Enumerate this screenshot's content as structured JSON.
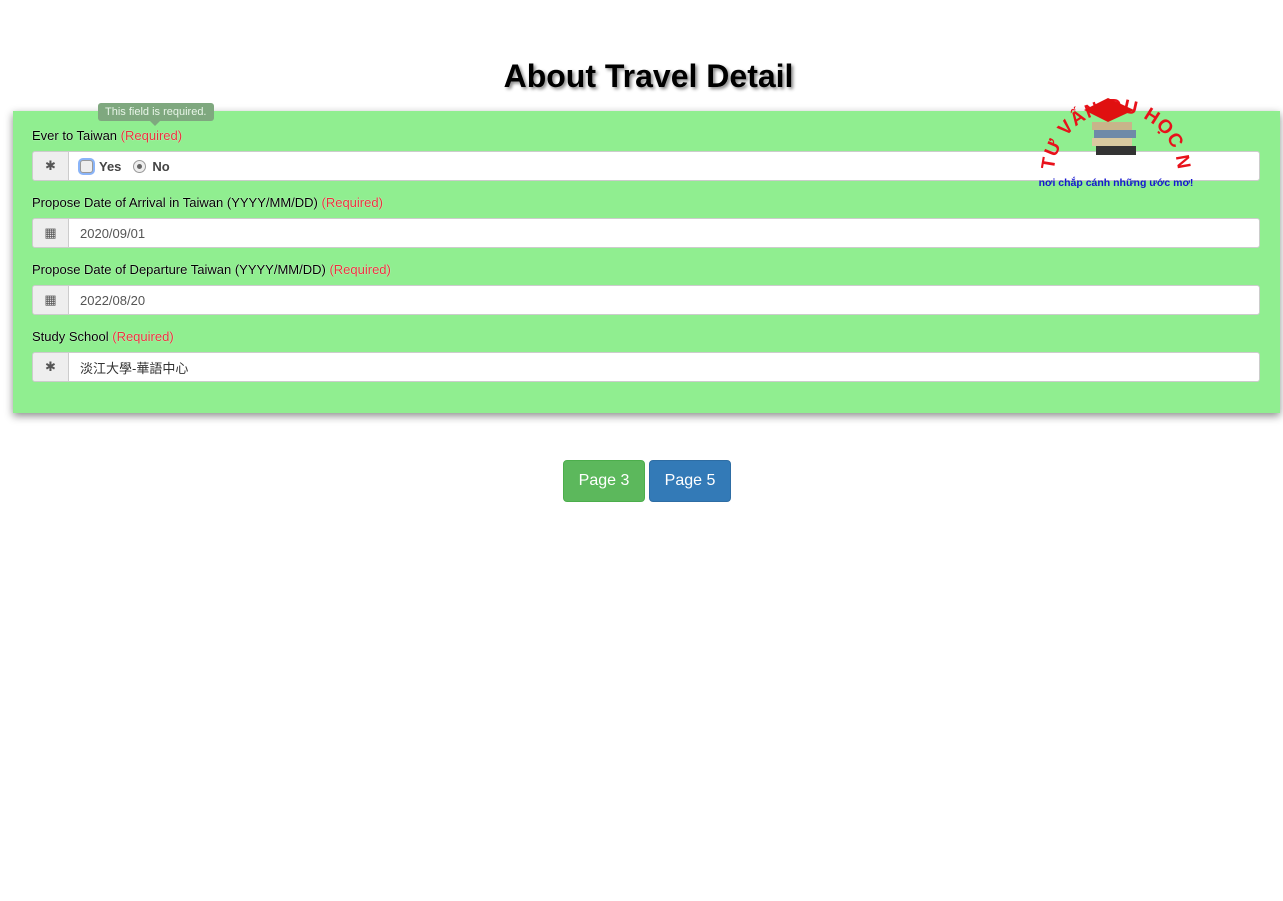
{
  "title": "About Travel Detail",
  "tooltip": "This field is required.",
  "required_mark": "(Required)",
  "fields": [
    {
      "label": "Ever to Taiwan",
      "icon": "asterisk-icon",
      "options": [
        "Yes",
        "No"
      ],
      "selected": "No"
    },
    {
      "label": "Propose Date of Arrival in Taiwan (YYYY/MM/DD)",
      "icon": "calendar-icon",
      "value": "2020/09/01"
    },
    {
      "label": "Propose Date of Departure Taiwan (YYYY/MM/DD)",
      "icon": "calendar-icon",
      "value": "2022/08/20"
    },
    {
      "label": "Study School",
      "icon": "asterisk-icon",
      "value": "淡江大學-華語中心"
    }
  ],
  "buttons": {
    "prev": "Page 3",
    "next": "Page 5"
  },
  "colors": {
    "panel": "#90ee90",
    "required": "#e8333a",
    "prev_button": "#5cb85c",
    "next_button": "#337ab7"
  },
  "logo": {
    "arc_text": "TƯ VẤN DU HỌC NHẬT ĐÀI",
    "slogan": "nơi chắp cánh những ước mơ!"
  }
}
